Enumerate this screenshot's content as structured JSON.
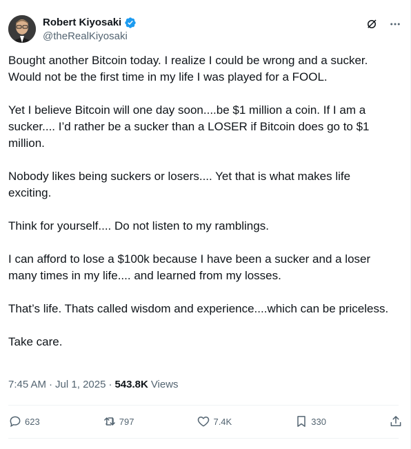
{
  "author": {
    "name": "Robert Kiyosaki",
    "handle": "@theRealKiyosaki",
    "verified_color": "#1d9bf0"
  },
  "tweet": {
    "paragraphs": [
      "Bought another Bitcoin today.  I realize I could be wrong and a sucker. Would not be the first time in my life I was played for a FOOL.",
      "Yet I believe Bitcoin will one day soon....be $1 million a coin.  If I am a sucker.... I’d rather be a sucker than a LOSER if Bitcoin does go to $1 million.",
      "Nobody likes being suckers or losers.... Yet that is what makes life exciting.",
      "Think for yourself.... Do not listen to my ramblings.",
      "I can afford to lose a $100k because I have been a sucker and a loser many times in my life.... and learned from my losses.",
      "That’s life.  Thats called wisdom and experience....which can be priceless.",
      "Take care."
    ]
  },
  "meta": {
    "time": "7:45 AM",
    "separator1": "·",
    "date": "Jul 1, 2025",
    "separator2": "·",
    "views_count": "543.8K",
    "views_label": "Views"
  },
  "actions": {
    "replies": "623",
    "reposts": "797",
    "likes": "7.4K",
    "bookmarks": "330"
  },
  "icons": {
    "grok": "grok-icon",
    "more": "more-icon",
    "reply": "reply-icon",
    "repost": "repost-icon",
    "like": "heart-icon",
    "bookmark": "bookmark-icon",
    "share": "share-icon"
  }
}
